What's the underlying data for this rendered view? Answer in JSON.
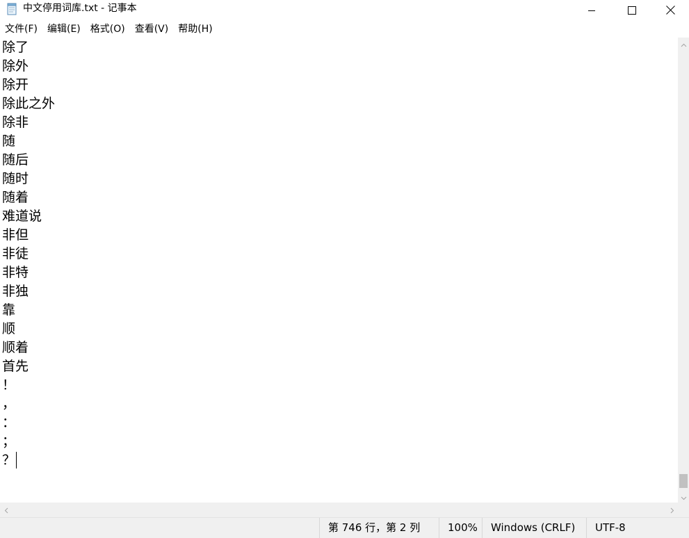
{
  "window": {
    "title": "中文停用词库.txt - 记事本"
  },
  "icons": {
    "app": "notepad-icon",
    "minimize": "minimize-icon",
    "maximize": "maximize-icon",
    "close": "close-icon"
  },
  "menu": {
    "file": "文件(F)",
    "edit": "编辑(E)",
    "format": "格式(O)",
    "view": "查看(V)",
    "help": "帮助(H)"
  },
  "editor": {
    "lines": [
      "除了",
      "除外",
      "除开",
      "除此之外",
      "除非",
      "随",
      "随后",
      "随时",
      "随着",
      "难道说",
      "非但",
      "非徒",
      "非特",
      "非独",
      "靠",
      "顺",
      "顺着",
      "首先",
      "！",
      "，",
      "：",
      "；",
      "？"
    ]
  },
  "status": {
    "position": "第 746 行，第 2 列",
    "zoom": "100%",
    "line_ending": "Windows (CRLF)",
    "encoding": "UTF-8"
  }
}
